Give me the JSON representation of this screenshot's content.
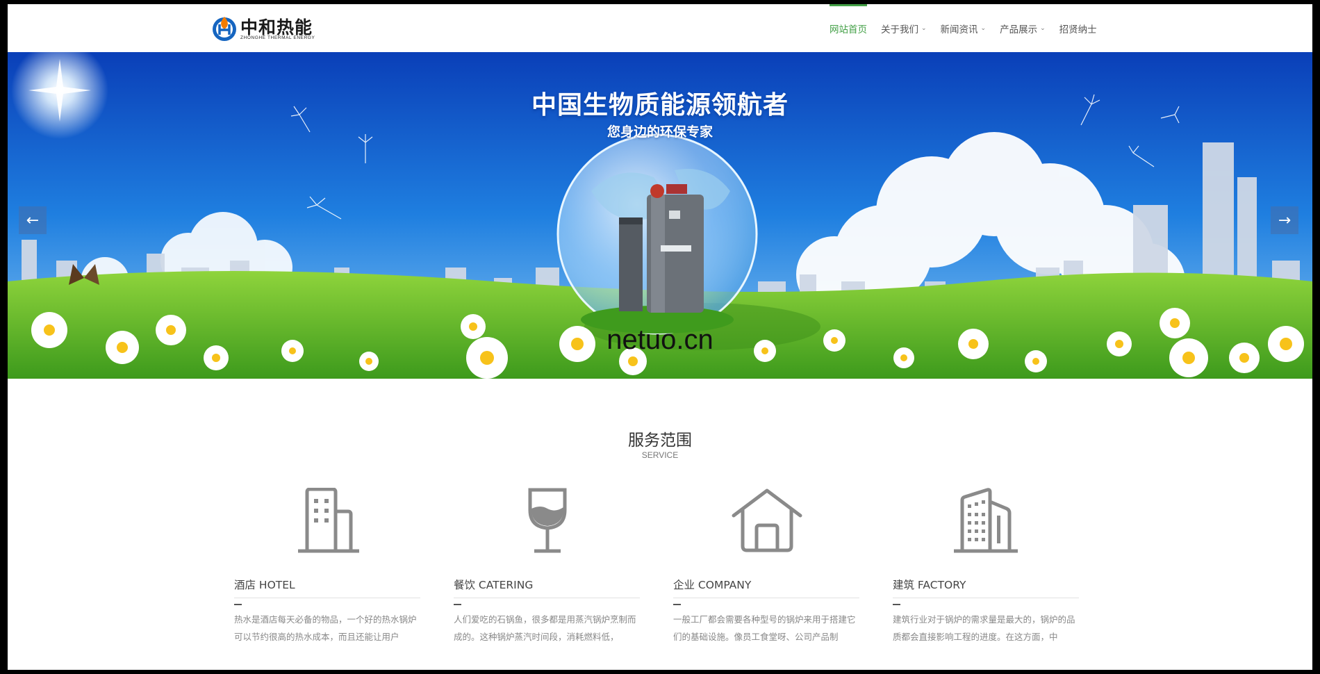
{
  "logo": {
    "name": "中和热能",
    "sub": "ZHONGHE THERMAL ENERGY"
  },
  "nav": {
    "items": [
      {
        "label": "网站首页",
        "active": true,
        "dropdown": false
      },
      {
        "label": "关于我们",
        "active": false,
        "dropdown": true
      },
      {
        "label": "新闻资讯",
        "active": false,
        "dropdown": true
      },
      {
        "label": "产品展示",
        "active": false,
        "dropdown": true
      },
      {
        "label": "招贤纳士",
        "active": false,
        "dropdown": false
      }
    ]
  },
  "banner": {
    "title": "中国生物质能源领航者",
    "subtitle": "您身边的环保专家",
    "watermark": "netuo.cn",
    "prev_icon": "←",
    "next_icon": "→"
  },
  "service": {
    "title": "服务范围",
    "subtitle": "SERVICE",
    "items": [
      {
        "icon": "hotel-building-icon",
        "title": "酒店 HOTEL",
        "desc": "热水是酒店每天必备的物品，一个好的热水锅炉可以节约很高的热水成本，而且还能让用户"
      },
      {
        "icon": "wine-glass-icon",
        "title": "餐饮 CATERING",
        "desc": "人们爱吃的石锅鱼，很多都是用蒸汽锅炉烹制而成的。这种锅炉蒸汽时间段，消耗燃料低，"
      },
      {
        "icon": "house-icon",
        "title": "企业 COMPANY",
        "desc": "一般工厂都会需要各种型号的锅炉来用于搭建它们的基础设施。像员工食堂呀、公司产品制"
      },
      {
        "icon": "factory-building-icon",
        "title": "建筑 FACTORY",
        "desc": "建筑行业对于锅炉的需求量是最大的，锅炉的品质都会直接影响工程的进度。在这方面，中"
      }
    ]
  },
  "colors": {
    "accent": "#43a047",
    "sky_top": "#0a3fb8",
    "grass": "#5cb82c",
    "icon_gray": "#8a8a8a"
  }
}
